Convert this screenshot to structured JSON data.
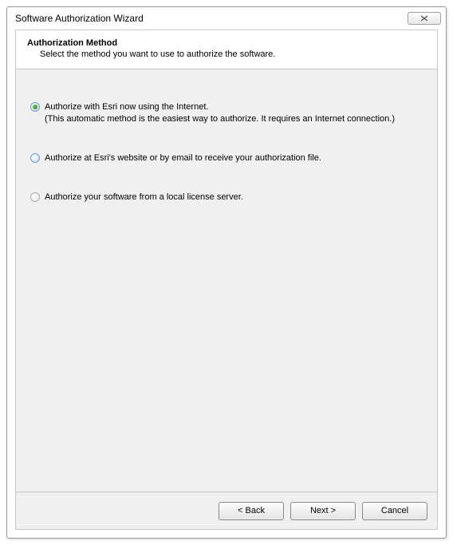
{
  "title": "Software Authorization Wizard",
  "header": {
    "title": "Authorization Method",
    "subtitle": "Select the method you want to use to authorize the software."
  },
  "options": [
    {
      "label": "Authorize with Esri now using the Internet.",
      "sub": "(This automatic method is the easiest way to authorize. It requires an Internet connection.)",
      "selected": true
    },
    {
      "label": "Authorize at Esri's website or by email to receive your authorization file.",
      "sub": "",
      "selected": false
    },
    {
      "label": "Authorize your software from a local license server.",
      "sub": "",
      "selected": false
    }
  ],
  "buttons": {
    "back": "< Back",
    "next": "Next >",
    "cancel": "Cancel"
  }
}
